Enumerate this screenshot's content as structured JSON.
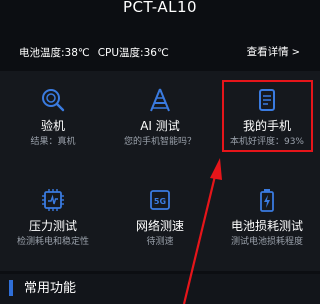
{
  "header": {
    "title": "PCT-AL10"
  },
  "info": {
    "battery_temp": "电池温度:38℃",
    "cpu_temp": "CPU温度:36℃",
    "details_link": "查看详情",
    "details_chevron": ">"
  },
  "tiles": [
    {
      "label": "验机",
      "sub": "结果：真机",
      "icon": "search-icon"
    },
    {
      "label": "AI 测试",
      "sub": "您的手机智能吗？",
      "icon": "ai-icon"
    },
    {
      "label": "我的手机",
      "sub": "本机好评度：93%",
      "icon": "phone-icon"
    },
    {
      "label": "压力测试",
      "sub": "检测耗电和稳定性",
      "icon": "chip-icon"
    },
    {
      "label": "网络测速",
      "sub": "待测速",
      "icon": "network-5g-icon"
    },
    {
      "label": "电池损耗测试",
      "sub": "测试电池损耗程度",
      "icon": "battery-icon"
    }
  ],
  "section": {
    "title": "常用功能"
  },
  "colors": {
    "accent": "#2f6fd8",
    "highlight": "#e6151a",
    "icon": "#3a7be0"
  }
}
